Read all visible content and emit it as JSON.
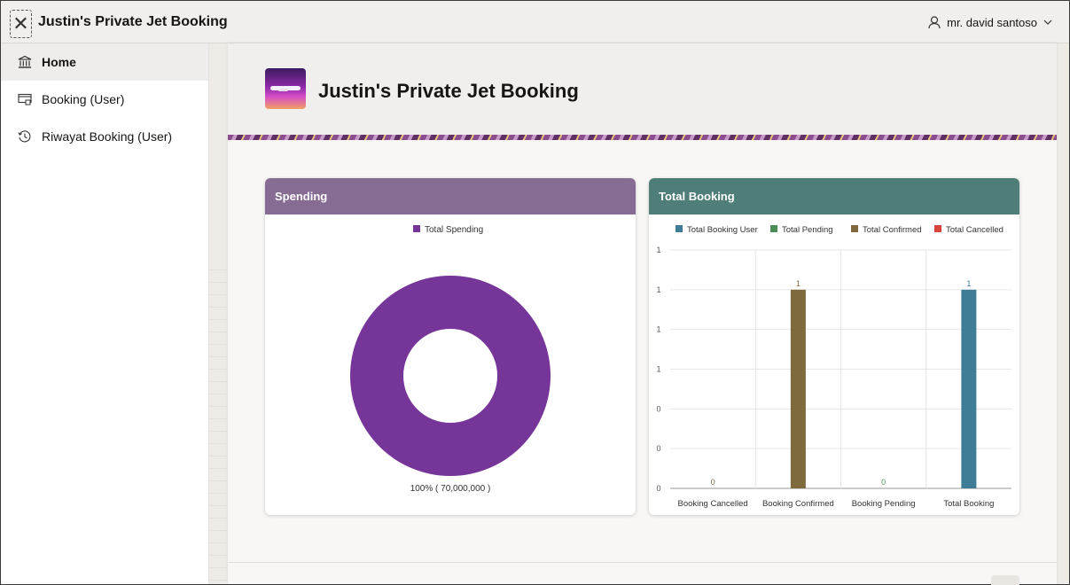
{
  "app": {
    "title": "Justin's Private Jet Booking",
    "user_name": "mr. david santoso"
  },
  "sidebar": {
    "items": [
      {
        "label": "Home",
        "icon": "bank-icon",
        "active": true
      },
      {
        "label": "Booking (User)",
        "icon": "booking-window-icon",
        "active": false
      },
      {
        "label": "Riwayat Booking (User)",
        "icon": "history-clock-icon",
        "active": false
      }
    ]
  },
  "hero": {
    "title": "Justin's Private Jet Booking"
  },
  "colors": {
    "spending_header": "#866b93",
    "booking_header": "#4f7d78",
    "spending_series": "#763598",
    "booking_user": "#3f7d97",
    "pending": "#4c8d57",
    "confirmed": "#7f6a3e",
    "cancelled": "#d7443b"
  },
  "spending_card": {
    "title": "Spending",
    "chart_data": {
      "type": "pie",
      "subtype": "donut",
      "legend": [
        "Total Spending"
      ],
      "slices": [
        {
          "name": "Total Spending",
          "value": 70000000,
          "percent": 100
        }
      ],
      "label": "100% ( 70,000,000 )"
    }
  },
  "booking_card": {
    "title": "Total Booking",
    "chart_data": {
      "type": "bar",
      "categories": [
        "Booking Cancelled",
        "Booking Confirmed",
        "Booking Pending",
        "Total Booking"
      ],
      "y_tick_labels": [
        "0",
        "0",
        "0",
        "1",
        "1",
        "1",
        "1"
      ],
      "ylim": [
        0,
        1.2
      ],
      "grid": true,
      "legend_position": "top",
      "series": [
        {
          "name": "Total Booking User",
          "values": [
            null,
            null,
            null,
            1
          ]
        },
        {
          "name": "Total Pending",
          "values": [
            null,
            null,
            0,
            null
          ]
        },
        {
          "name": "Total Confirmed",
          "values": [
            0,
            1,
            null,
            null
          ]
        },
        {
          "name": "Total Cancelled",
          "values": [
            null,
            null,
            null,
            null
          ]
        }
      ]
    }
  }
}
